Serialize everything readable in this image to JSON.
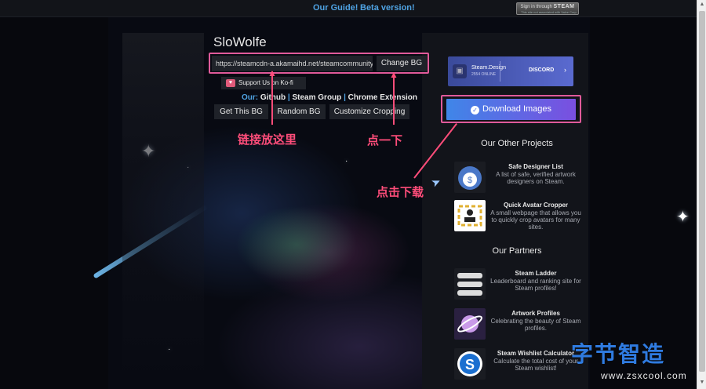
{
  "topbar": {
    "our_guide": "Our Guide!",
    "beta": "Beta version!",
    "signin_line1": "Sign in through",
    "signin_steam": "STEAM",
    "signin_note": "This site not associated with Valve Corp."
  },
  "profile": {
    "name": "SloWolfe",
    "url_value": "https://steamcdn-a.akamaihd.net/steamcommunity/pul",
    "change_bg": "Change BG",
    "kofi": "Support Us on Ko-fi",
    "our_label": "Our:",
    "links": [
      "Github",
      "Steam Group",
      "Chrome Extension"
    ],
    "separator": "|",
    "actions": [
      "Get This BG",
      "Random BG",
      "Customize Cropping"
    ]
  },
  "right": {
    "steam_design_title": "Steam.Design",
    "steam_design_sub": "2554 ONLINE",
    "discord": "DISCORD",
    "download": "Download Images",
    "other_projects": "Our Other Projects",
    "projects": [
      {
        "title": "Safe Designer List",
        "desc": "A list of safe, verified artwork designers on Steam."
      },
      {
        "title": "Quick Avatar Cropper",
        "desc": "A small webpage that allows you to quickly crop avatars for many sites."
      }
    ],
    "partners_title": "Our Partners",
    "partners": [
      {
        "title": "Steam Ladder",
        "desc": "Leaderboard and ranking site for Steam profiles!"
      },
      {
        "title": "Artwork Profiles",
        "desc": "Celebrating the beauty of Steam profiles."
      },
      {
        "title": "Steam Wishlist Calculator",
        "desc": "Calculate the total cost of your Steam wishlist!"
      }
    ]
  },
  "annotations": {
    "paste_here": "链接放这里",
    "click_once": "点一下",
    "click_download": "点击下载",
    "color": "#ff4d7a"
  },
  "watermark": {
    "brand": "字节智造",
    "url": "www.zsxcool.com"
  }
}
